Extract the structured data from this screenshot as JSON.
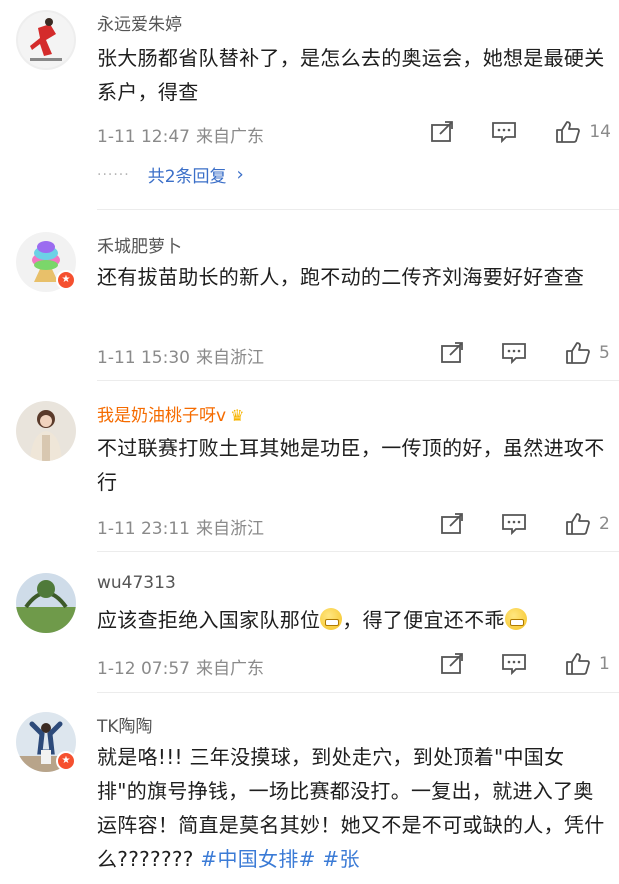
{
  "comments": [
    {
      "username": "永远爱朱婷",
      "text": "张大肠都省队替补了，是怎么去的奥运会，她想是最硬关系户，得查",
      "time": "1-11 12:47",
      "location": "来自广东",
      "likes": "14",
      "replies": "共2条回复"
    },
    {
      "username": "禾城肥萝卜",
      "text": "还有拔苗助长的新人，跑不动的二传齐刘海要好好查查",
      "time": "1-11 15:30",
      "location": "来自浙江",
      "likes": "5"
    },
    {
      "username": "我是奶油桃子呀v",
      "text": "不过联赛打败土耳其她是功臣，一传顶的好，虽然进攻不行",
      "time": "1-11 23:11",
      "location": "来自浙江",
      "likes": "2"
    },
    {
      "username": "wu47313",
      "text_a": "应该查拒绝入国家队那位",
      "text_b": "，得了便宜还不乖",
      "time": "1-12 07:57",
      "location": "来自广东",
      "likes": "1"
    },
    {
      "username": "TK陶陶",
      "text_a": "就是咯!!! 三年没摸球，到处走穴，到处顶着\"中国女排\"的旗号挣钱，一场比赛都没打。一复出，就进入了奥运阵容！简直是莫名其妙！她又不是不可或缺的人，凭什么???????",
      "hashtag_1": "#中国女排#",
      "hashtag_2": "#张"
    }
  ],
  "colors": {
    "link": "#3b6fc8",
    "hashtag": "#3b7bd6",
    "vip_name": "#f56b00",
    "meta": "#8a8a8a",
    "badge": "#f5502f"
  },
  "icons": {
    "share": "share-icon",
    "reply": "comment-icon",
    "like": "thumb-up-icon",
    "chevron": "chevron-right-icon",
    "crown": "crown-icon"
  }
}
